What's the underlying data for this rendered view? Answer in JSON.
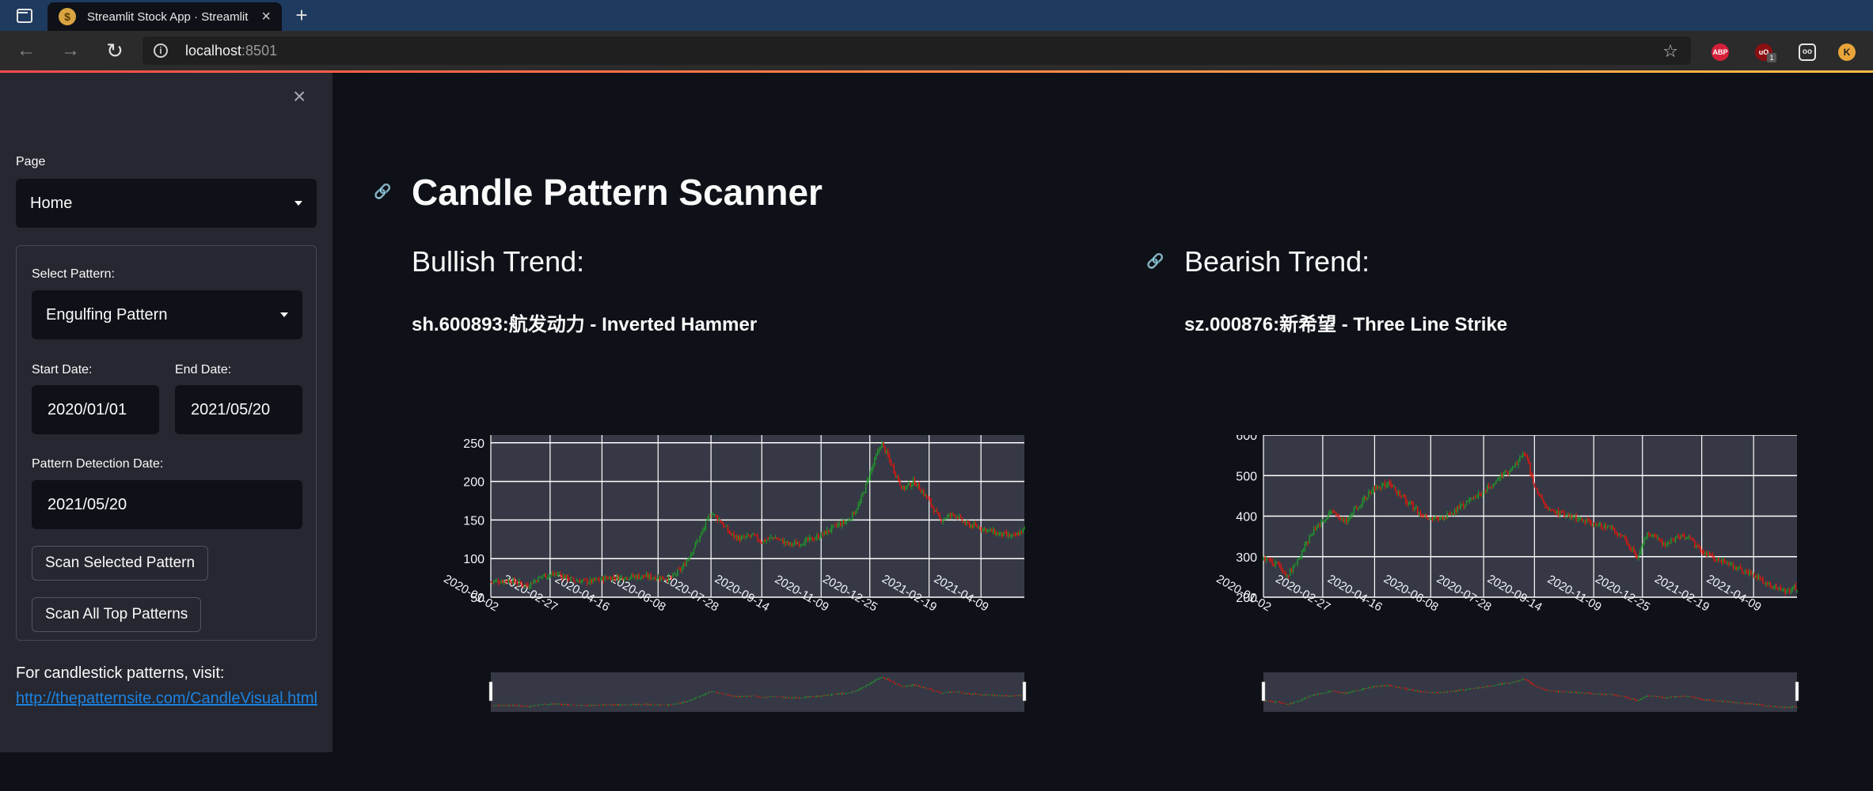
{
  "browser": {
    "tab_title": "Streamlit Stock App · Streamlit",
    "tab_favicon": "moneybag-icon",
    "new_tab": "+",
    "url_host": "localhost",
    "url_port": ":8501",
    "extensions": {
      "abp": "ABP",
      "ublock": "uO",
      "ublock_badge": "1",
      "glasses": "oo",
      "keeper": "K"
    }
  },
  "sidebar": {
    "close": "×",
    "page_label": "Page",
    "page_value": "Home",
    "select_pattern_label": "Select Pattern:",
    "select_pattern_value": "Engulfing Pattern",
    "start_date_label": "Start Date:",
    "start_date_value": "2020/01/01",
    "end_date_label": "End Date:",
    "end_date_value": "2021/05/20",
    "detection_date_label": "Pattern Detection Date:",
    "detection_date_value": "2021/05/20",
    "scan_selected_button": "Scan Selected Pattern",
    "scan_all_button": "Scan All Top Patterns",
    "footer_text": "For candlestick patterns, visit:",
    "footer_link": "http://thepatternsite.com/CandleVisual.html"
  },
  "main": {
    "title": "Candle Pattern Scanner",
    "anchor": "🔗",
    "bullish_heading": "Bullish Trend:",
    "bullish_stock": "sh.600893:航发动力 - Inverted Hammer",
    "bearish_heading": "Bearish Trend:",
    "bearish_stock": "sz.000876:新希望 - Three Line Strike"
  },
  "colors": {
    "up": "#1f9d2a",
    "down": "#e8140c",
    "plot_bg": "#363945",
    "grid": "#ffffff",
    "page_bg": "#0e1117",
    "sidebar_bg": "#262730",
    "link": "#1c83e1"
  },
  "chart_data": [
    {
      "type": "candlestick",
      "ylim": [
        50,
        260
      ],
      "yticks": [
        50,
        100,
        150,
        200,
        250
      ],
      "xticks": [
        "2020-01-02",
        "2020-02-27",
        "2020-04-16",
        "2020-06-08",
        "2020-07-28",
        "2020-09-14",
        "2020-11-09",
        "2020-12-25",
        "2021-02-19",
        "2021-04-09"
      ],
      "close_path": [
        [
          "2020-01-02",
          70
        ],
        [
          "2020-01-20",
          72
        ],
        [
          "2020-02-05",
          65
        ],
        [
          "2020-02-20",
          78
        ],
        [
          "2020-03-05",
          80
        ],
        [
          "2020-03-20",
          72
        ],
        [
          "2020-04-05",
          70
        ],
        [
          "2020-04-20",
          75
        ],
        [
          "2020-05-05",
          76
        ],
        [
          "2020-05-20",
          77
        ],
        [
          "2020-06-05",
          76
        ],
        [
          "2020-06-20",
          74
        ],
        [
          "2020-07-01",
          88
        ],
        [
          "2020-07-10",
          110
        ],
        [
          "2020-07-20",
          135
        ],
        [
          "2020-07-28",
          160
        ],
        [
          "2020-08-05",
          150
        ],
        [
          "2020-08-15",
          132
        ],
        [
          "2020-08-25",
          125
        ],
        [
          "2020-09-05",
          130
        ],
        [
          "2020-09-14",
          122
        ],
        [
          "2020-09-25",
          128
        ],
        [
          "2020-10-10",
          118
        ],
        [
          "2020-10-25",
          122
        ],
        [
          "2020-11-09",
          130
        ],
        [
          "2020-11-20",
          140
        ],
        [
          "2020-12-05",
          150
        ],
        [
          "2020-12-15",
          170
        ],
        [
          "2020-12-25",
          210
        ],
        [
          "2021-01-05",
          250
        ],
        [
          "2021-01-15",
          220
        ],
        [
          "2021-01-25",
          190
        ],
        [
          "2021-02-05",
          200
        ],
        [
          "2021-02-19",
          175
        ],
        [
          "2021-03-01",
          150
        ],
        [
          "2021-03-15",
          158
        ],
        [
          "2021-03-25",
          145
        ],
        [
          "2021-04-09",
          140
        ],
        [
          "2021-04-25",
          132
        ],
        [
          "2021-05-10",
          128
        ],
        [
          "2021-05-20",
          138
        ]
      ]
    },
    {
      "type": "candlestick",
      "ylim": [
        200,
        600
      ],
      "yticks": [
        200,
        300,
        400,
        500,
        600
      ],
      "xticks": [
        "2020-01-02",
        "2020-02-27",
        "2020-04-16",
        "2020-06-08",
        "2020-07-28",
        "2020-09-14",
        "2020-11-09",
        "2020-12-25",
        "2021-02-19",
        "2021-04-09"
      ],
      "close_path": [
        [
          "2020-01-02",
          295
        ],
        [
          "2020-01-15",
          280
        ],
        [
          "2020-01-25",
          255
        ],
        [
          "2020-02-05",
          300
        ],
        [
          "2020-02-20",
          370
        ],
        [
          "2020-03-05",
          410
        ],
        [
          "2020-03-20",
          390
        ],
        [
          "2020-04-05",
          440
        ],
        [
          "2020-04-16",
          470
        ],
        [
          "2020-04-30",
          480
        ],
        [
          "2020-05-15",
          440
        ],
        [
          "2020-05-30",
          405
        ],
        [
          "2020-06-08",
          390
        ],
        [
          "2020-06-25",
          400
        ],
        [
          "2020-07-10",
          430
        ],
        [
          "2020-07-28",
          460
        ],
        [
          "2020-08-10",
          490
        ],
        [
          "2020-08-25",
          520
        ],
        [
          "2020-09-05",
          560
        ],
        [
          "2020-09-14",
          470
        ],
        [
          "2020-09-25",
          420
        ],
        [
          "2020-10-10",
          405
        ],
        [
          "2020-10-25",
          395
        ],
        [
          "2020-11-09",
          380
        ],
        [
          "2020-11-25",
          370
        ],
        [
          "2020-12-10",
          340
        ],
        [
          "2020-12-20",
          300
        ],
        [
          "2020-12-30",
          360
        ],
        [
          "2021-01-15",
          330
        ],
        [
          "2021-01-25",
          345
        ],
        [
          "2021-02-05",
          350
        ],
        [
          "2021-02-19",
          310
        ],
        [
          "2021-03-05",
          295
        ],
        [
          "2021-03-20",
          280
        ],
        [
          "2021-04-09",
          255
        ],
        [
          "2021-04-25",
          230
        ],
        [
          "2021-05-10",
          215
        ],
        [
          "2021-05-20",
          225
        ]
      ]
    }
  ]
}
